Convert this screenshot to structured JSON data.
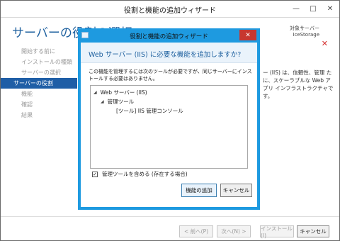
{
  "outer_window": {
    "title": "役割と機能の追加ウィザード",
    "controls": [
      "—",
      "□",
      "✕"
    ],
    "page_heading": "サーバーの役割の選択",
    "target_server_label": "対象サーバー",
    "target_server_name": "IceStorage"
  },
  "nav": {
    "items": [
      {
        "label": "開始する前に"
      },
      {
        "label": "インストールの種類"
      },
      {
        "label": "サーバーの選択"
      },
      {
        "label": "サーバーの役割"
      },
      {
        "label": "機能"
      },
      {
        "label": "確認"
      },
      {
        "label": "結果"
      }
    ]
  },
  "background_text": "ー (IIS) は、信頼性、管理 たに、スケーラブルな Web アプリ インフラストラクチャです。",
  "bottom_bar": {
    "prev": "< 前へ(P)",
    "next": "次へ(N) >",
    "install": "インストール(I)",
    "cancel": "キャンセル"
  },
  "dialog": {
    "title": "役割と機能の追加ウィザード",
    "heading": "Web サーバー (IIS) に必要な機能を追加しますか?",
    "description": "この機能を管理するには次のツールが必要ですが、同じサーバーにインストールする必要はありません。",
    "tree": [
      {
        "label": "Web サーバー (IIS)"
      },
      {
        "label": "管理ツール"
      },
      {
        "label": "[ツール] IIS 管理コンソール"
      }
    ],
    "checkbox_label": "管理ツールを含める (存在する場合)",
    "checkbox_checked": true,
    "checkbox_mark": "✓",
    "add_button": "機能の追加",
    "cancel_button": "キャンセル"
  }
}
